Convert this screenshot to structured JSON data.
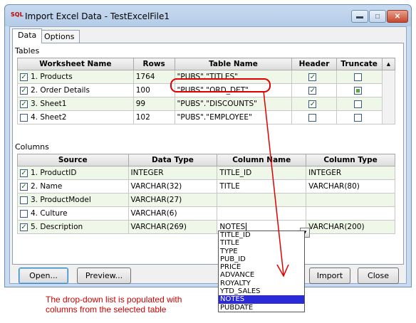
{
  "window": {
    "app_icon_text": "SQL",
    "title": "Import Excel Data - TestExcelFile1",
    "min_glyph": "▬",
    "max_glyph": "□",
    "close_glyph": "✕"
  },
  "tabs": [
    {
      "label": "Data",
      "active": true
    },
    {
      "label": "Options",
      "active": false
    }
  ],
  "tables_section": {
    "label": "Tables",
    "headers": [
      "Worksheet Name",
      "Rows",
      "Table Name",
      "Header",
      "Truncate"
    ],
    "rows": [
      {
        "checked": true,
        "name": "1. Products",
        "rows": "1764",
        "table": "\"PUBS\".\"TITLES\"",
        "header": true,
        "truncate": false
      },
      {
        "checked": true,
        "name": "2. Order Details",
        "rows": "100",
        "table": "\"PUBS\".\"ORD_DET\"",
        "header": true,
        "truncate": "partial"
      },
      {
        "checked": true,
        "name": "3. Sheet1",
        "rows": "99",
        "table": "\"PUBS\".\"DISCOUNTS\"",
        "header": true,
        "truncate": false
      },
      {
        "checked": false,
        "name": "4. Sheet2",
        "rows": "102",
        "table": "\"PUBS\".\"EMPLOYEE\"",
        "header": false,
        "truncate": false
      }
    ]
  },
  "columns_section": {
    "label": "Columns",
    "headers": [
      "Source",
      "Data Type",
      "Column Name",
      "Column Type"
    ],
    "rows": [
      {
        "checked": true,
        "source": "1. ProductID",
        "dtype": "INTEGER",
        "colname": "TITLE_ID",
        "coltype": "INTEGER"
      },
      {
        "checked": true,
        "source": "2. Name",
        "dtype": "VARCHAR(32)",
        "colname": "TITLE",
        "coltype": "VARCHAR(80)"
      },
      {
        "checked": false,
        "source": "3. ProductModel",
        "dtype": "VARCHAR(27)",
        "colname": "",
        "coltype": ""
      },
      {
        "checked": false,
        "source": "4. Culture",
        "dtype": "VARCHAR(6)",
        "colname": "",
        "coltype": ""
      },
      {
        "checked": true,
        "source": "5. Description",
        "dtype": "VARCHAR(269)",
        "colname": "NOTES",
        "coltype": "VARCHAR(200)"
      }
    ]
  },
  "dropdown": {
    "options": [
      "TITLE_ID",
      "TITLE",
      "TYPE",
      "PUB_ID",
      "PRICE",
      "ADVANCE",
      "ROYALTY",
      "YTD_SALES",
      "NOTES",
      "PUBDATE"
    ],
    "selected": "NOTES"
  },
  "buttons": {
    "open": "Open...",
    "preview": "Preview...",
    "import": "Import",
    "close": "Close"
  },
  "annotation": {
    "line1": "The drop-down list is populated with",
    "line2": "columns from the selected table",
    "color": "#d00000"
  }
}
